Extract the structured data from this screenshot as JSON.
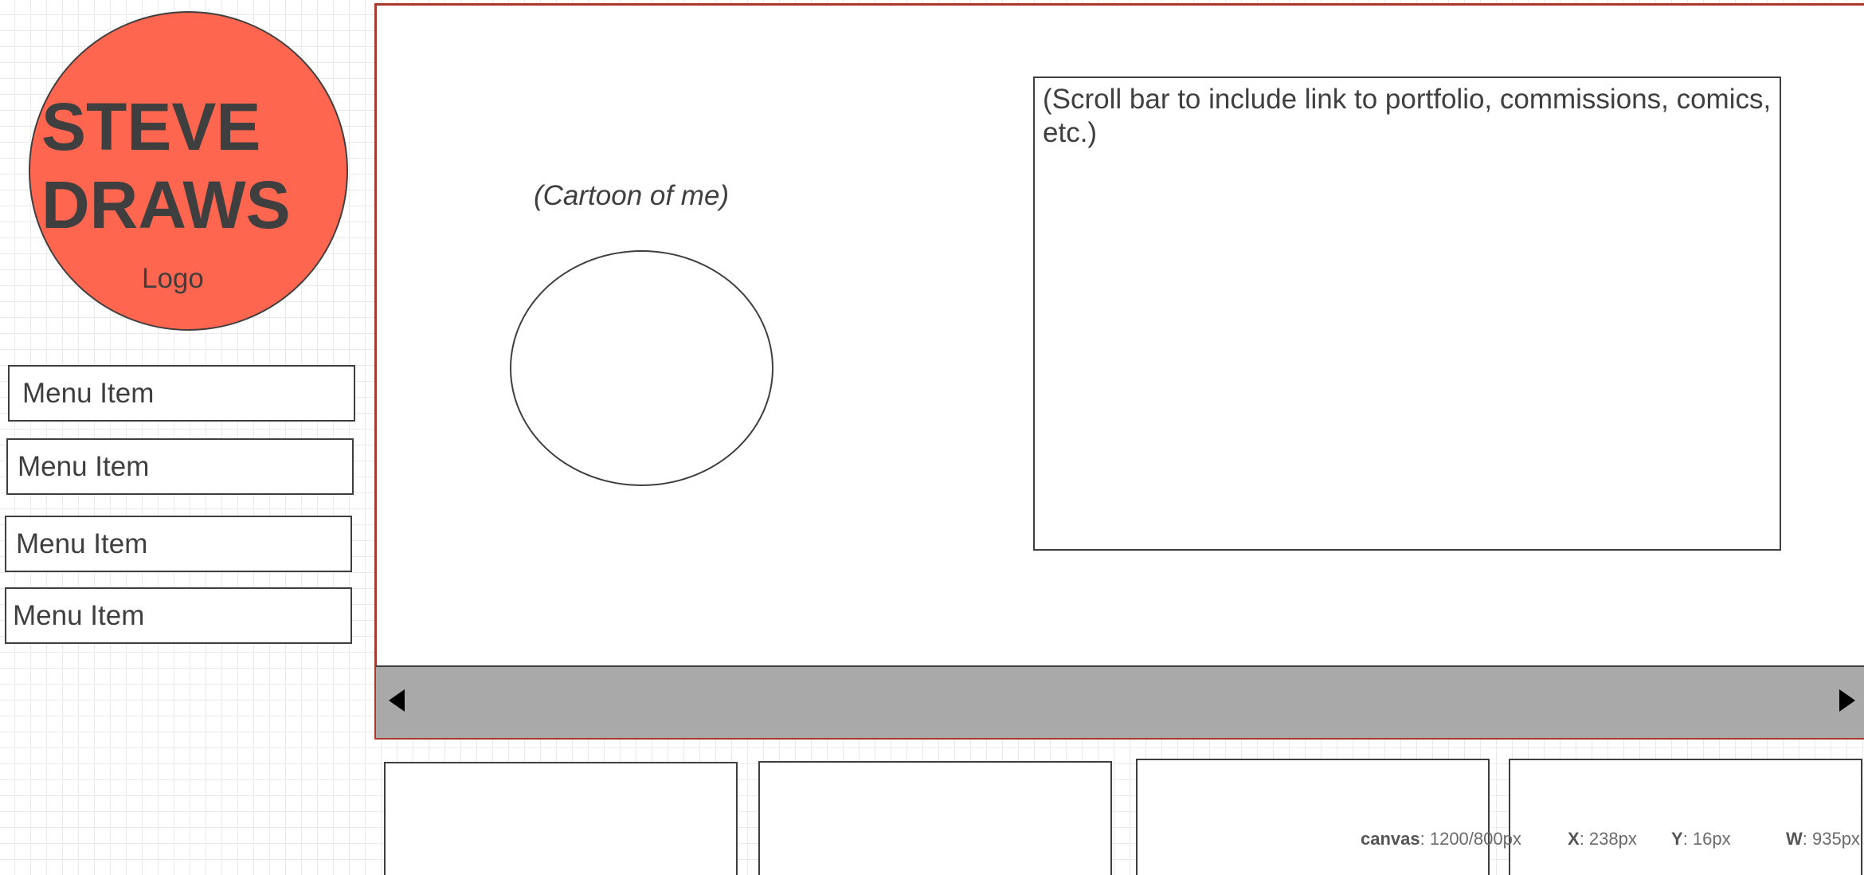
{
  "logo": {
    "title": "STEVE\nDRAWS",
    "subtitle": "Logo",
    "color": "#fe6650"
  },
  "menu": {
    "items": [
      {
        "label": "Menu Item"
      },
      {
        "label": "Menu Item"
      },
      {
        "label": "Menu Item"
      },
      {
        "label": "Menu Item"
      }
    ]
  },
  "main": {
    "cartoon_caption": "(Cartoon of me)",
    "note": "(Scroll bar to include link to portfolio, commissions, comics, etc.)",
    "frame_color": "#a9392c",
    "scrollbar_color": "#a9a9a9",
    "scroll_left_icon": "triangle-left-icon",
    "scroll_right_icon": "triangle-right-icon"
  },
  "status": {
    "canvas_label": "canvas",
    "canvas_value": ": 1200/800px",
    "x_label": "X",
    "x_value": ": 238px",
    "y_label": "Y",
    "y_value": ": 16px",
    "w_label": "W",
    "w_value": ": 935px"
  }
}
